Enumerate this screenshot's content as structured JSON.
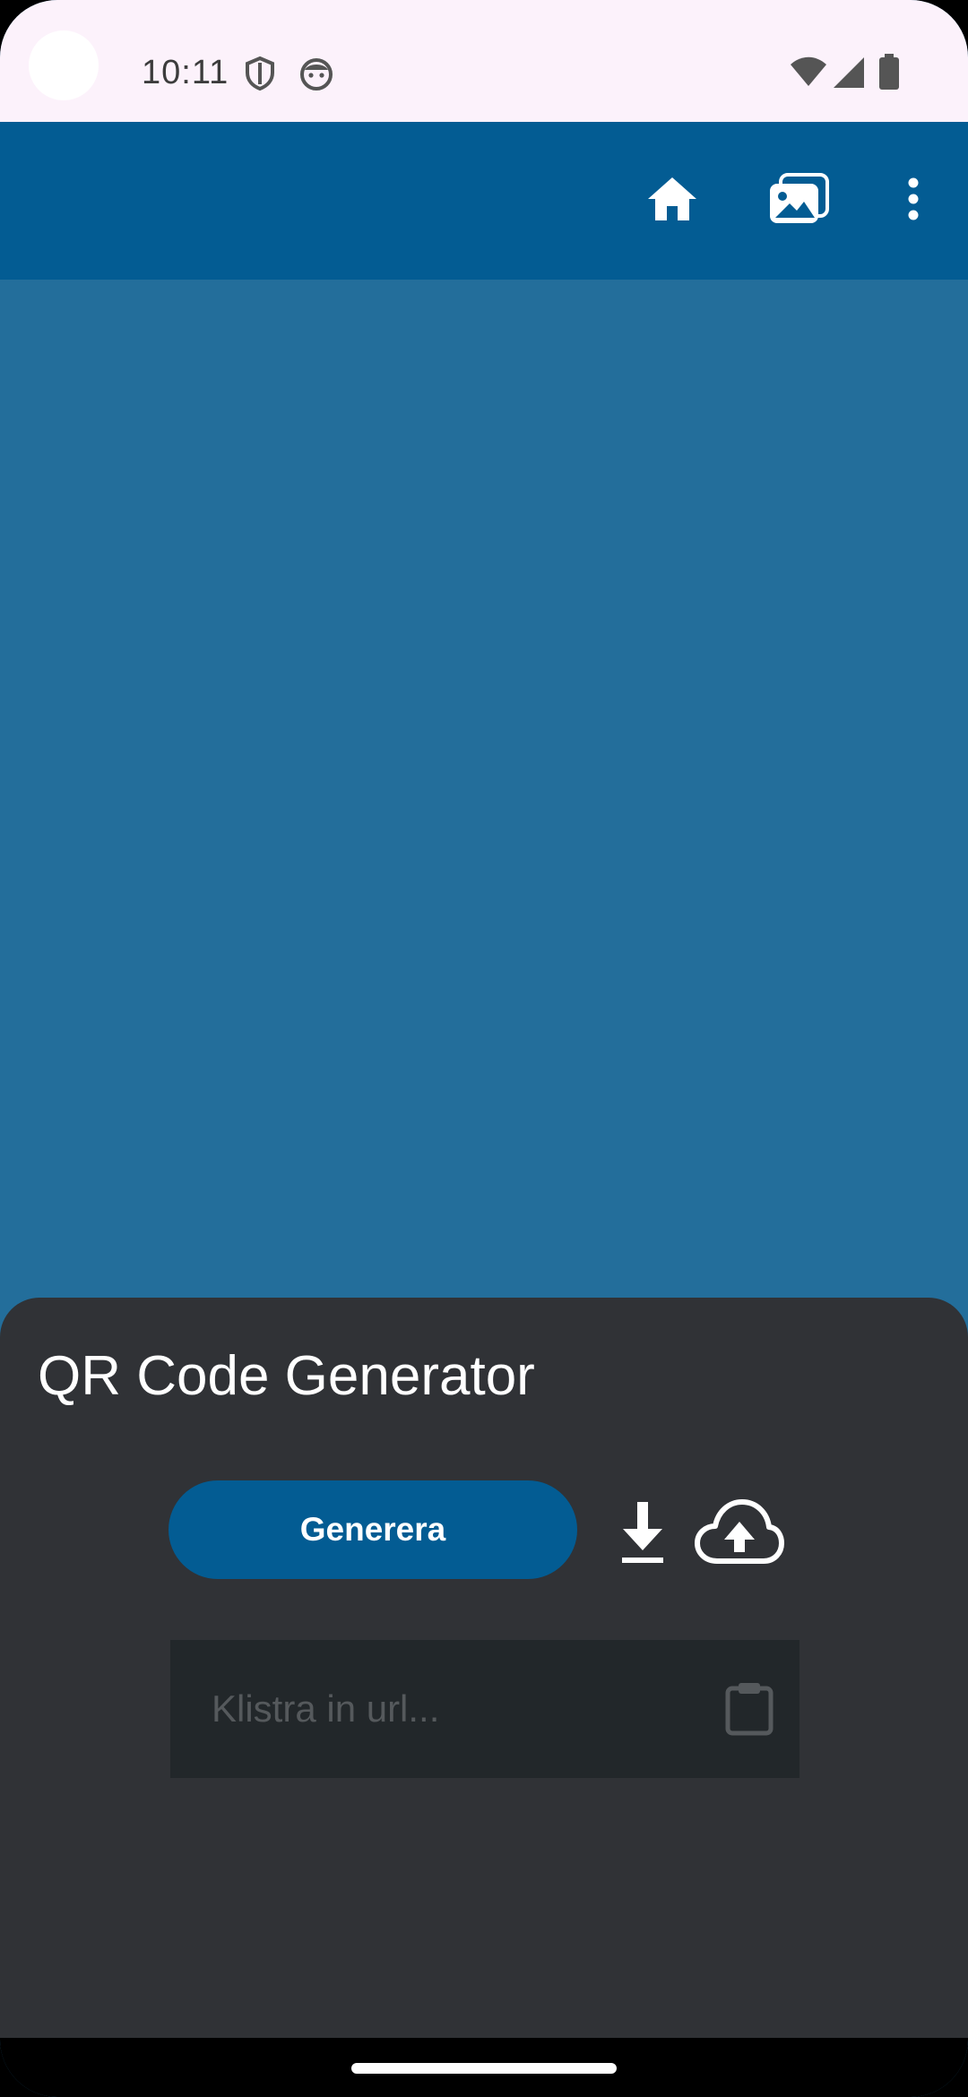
{
  "status_bar": {
    "time": "10:11",
    "icons": [
      "shield-icon",
      "face-icon",
      "wifi-icon",
      "cellular-signal-icon",
      "battery-icon"
    ]
  },
  "app_bar": {
    "background": "#035c93",
    "actions": [
      "home-icon",
      "gallery-icon",
      "more-vert-icon"
    ]
  },
  "sheet": {
    "title": "QR Code Generator",
    "generate_label": "Generera",
    "url_placeholder": "Klistra in url...",
    "url_value": "",
    "actions": [
      "download-icon",
      "cloud-upload-icon",
      "clipboard-icon"
    ]
  },
  "colors": {
    "primary": "#035c93",
    "content_background": "#236e9b",
    "sheet_background": "#303236",
    "field_background": "#22272a",
    "status_bar_background": "#fcf2fb"
  }
}
